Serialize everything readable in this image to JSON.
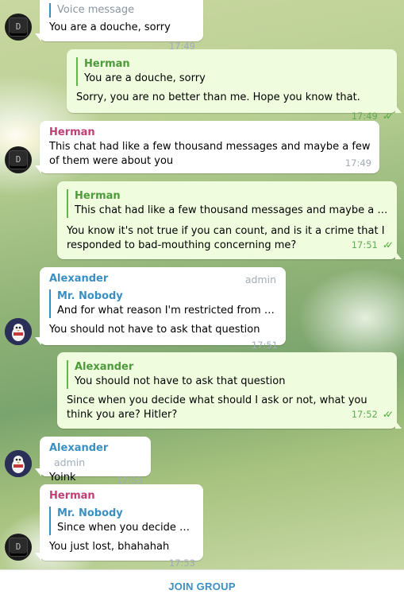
{
  "messages": [
    {
      "reply_text": "Voice message",
      "text": "You are a douche, sorry",
      "time": "17:49"
    },
    {
      "reply_name": "Herman",
      "reply_text": "You are a douche, sorry",
      "text": "Sorry, you are no better than me. Hope you know that.",
      "time": "17:49"
    },
    {
      "sender": "Herman",
      "text": "This chat had like a few thousand messages and maybe a few of them were about you",
      "time": "17:49"
    },
    {
      "reply_name": "Herman",
      "reply_text": "This chat had like a few thousand messages and maybe a few of t...",
      "text": "You know it's not true if you can count, and is it a crime that I responded to bad-mouthing concerning me?",
      "time": "17:51"
    },
    {
      "sender": "Alexander",
      "role": "admin",
      "reply_name": "Mr. Nobody",
      "reply_text": "And for what reason I'm restricted from send...",
      "text": "You should not have to ask that question",
      "time": "17:51"
    },
    {
      "reply_name": "Alexander",
      "reply_text": "You should not have to ask that question",
      "text": "Since when you decide what should I ask or not, what you think you are? Hitler?",
      "time": "17:52"
    },
    {
      "sender": "Alexander",
      "role": "admin",
      "text": "Yoink",
      "time": "17:53"
    },
    {
      "sender": "Herman",
      "reply_name": "Mr. Nobody",
      "reply_text": "Since when you decide wh...",
      "text": "You just lost, bhahahah",
      "time": "17:53"
    }
  ],
  "footer": {
    "join_label": "JOIN GROUP"
  },
  "colors": {
    "herman": "#c03d76",
    "alexander": "#3a8fc2",
    "outgoing": "#effdde",
    "accent": "#3a8fc2"
  },
  "icons": {
    "read_receipt": "double-check-icon",
    "avatar_herman": "keyboard-key-avatar",
    "avatar_alexander": "penguin-avatar"
  }
}
